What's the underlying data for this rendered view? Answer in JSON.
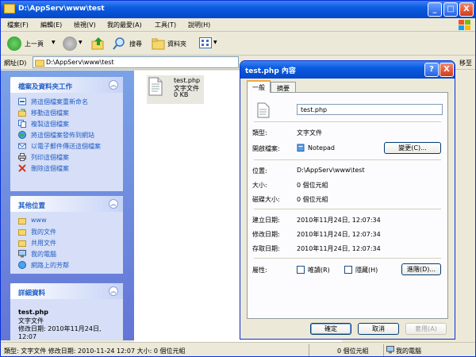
{
  "window": {
    "title": "D:\\AppServ\\www\\test",
    "minimize": "_",
    "maximize": "□",
    "close": "X"
  },
  "menu": [
    "檔案(F)",
    "編輯(E)",
    "檢視(V)",
    "我的最愛(A)",
    "工具(T)",
    "說明(H)"
  ],
  "toolbar": {
    "back": "上一頁",
    "search": "搜尋",
    "folders": "資料夾"
  },
  "address": {
    "label": "網址(D)",
    "value": "D:\\AppServ\\www\\test",
    "go": "移至"
  },
  "tasks": {
    "file_tasks": {
      "title": "檔案及資料夾工作",
      "items": [
        "將這個檔案重新命名",
        "移動這個檔案",
        "複製這個檔案",
        "將這個檔案發佈到網站",
        "以電子郵件傳送這個檔案",
        "列印這個檔案",
        "刪除這個檔案"
      ]
    },
    "other_places": {
      "title": "其他位置",
      "items": [
        "www",
        "我的文件",
        "共用文件",
        "我的電腦",
        "網路上的芳鄰"
      ]
    },
    "details": {
      "title": "詳細資料",
      "name": "test.php",
      "type": "文字文件",
      "modified": "修改日期: 2010年11月24日, 12:07"
    }
  },
  "file_item": {
    "name": "test.php",
    "type": "文字文件",
    "size": "0 KB"
  },
  "status": {
    "text": "類型: 文字文件 修改日期: 2010-11-24 12:07 大小: 0 個位元組",
    "size": "0 個位元組",
    "location": "我的電腦"
  },
  "dialog": {
    "title": "test.php 內容",
    "help": "?",
    "close": "X",
    "tabs": [
      "一般",
      "摘要"
    ],
    "filename": "test.php",
    "type_label": "類型:",
    "type_value": "文字文件",
    "opens_label": "開啟檔案:",
    "opens_value": "Notepad",
    "change_button": "變更(C)...",
    "location_label": "位置:",
    "location_value": "D:\\AppServ\\www\\test",
    "size_label": "大小:",
    "size_value": "0 個位元組",
    "disk_size_label": "磁碟大小:",
    "disk_size_value": "0 個位元組",
    "created_label": "建立日期:",
    "created_value": "2010年11月24日, 12:07:34",
    "modified_label": "修改日期:",
    "modified_value": "2010年11月24日, 12:07:34",
    "accessed_label": "存取日期:",
    "accessed_value": "2010年11月24日, 12:07:34",
    "attributes_label": "屬性:",
    "readonly_label": "唯讀(R)",
    "hidden_label": "隱藏(H)",
    "advanced_button": "進階(D)...",
    "ok_button": "確定",
    "cancel_button": "取消",
    "apply_button": "套用(A)"
  }
}
